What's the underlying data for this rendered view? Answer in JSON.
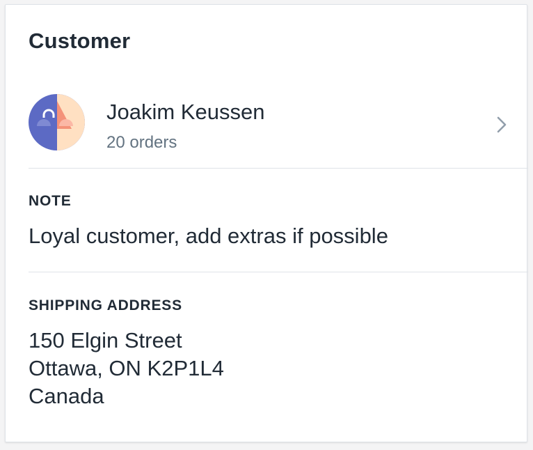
{
  "card": {
    "title": "Customer"
  },
  "customer": {
    "name": "Joakim Keussen",
    "orders": "20 orders",
    "avatar_icon": "customer-avatar-illustration",
    "chevron_icon": "chevron-right-icon"
  },
  "note": {
    "heading": "NOTE",
    "text": "Loyal customer, add extras if possible"
  },
  "shipping": {
    "heading": "SHIPPING ADDRESS",
    "lines": [
      "150 Elgin Street",
      "Ottawa, ON K2P1L4",
      "Canada"
    ]
  },
  "colors": {
    "text_primary": "#212b36",
    "text_subdued": "#637381",
    "divider": "#dfe3e8",
    "avatar_blue": "#5c6ac4",
    "avatar_peach": "#ffe0c2",
    "avatar_coral": "#f49279"
  }
}
